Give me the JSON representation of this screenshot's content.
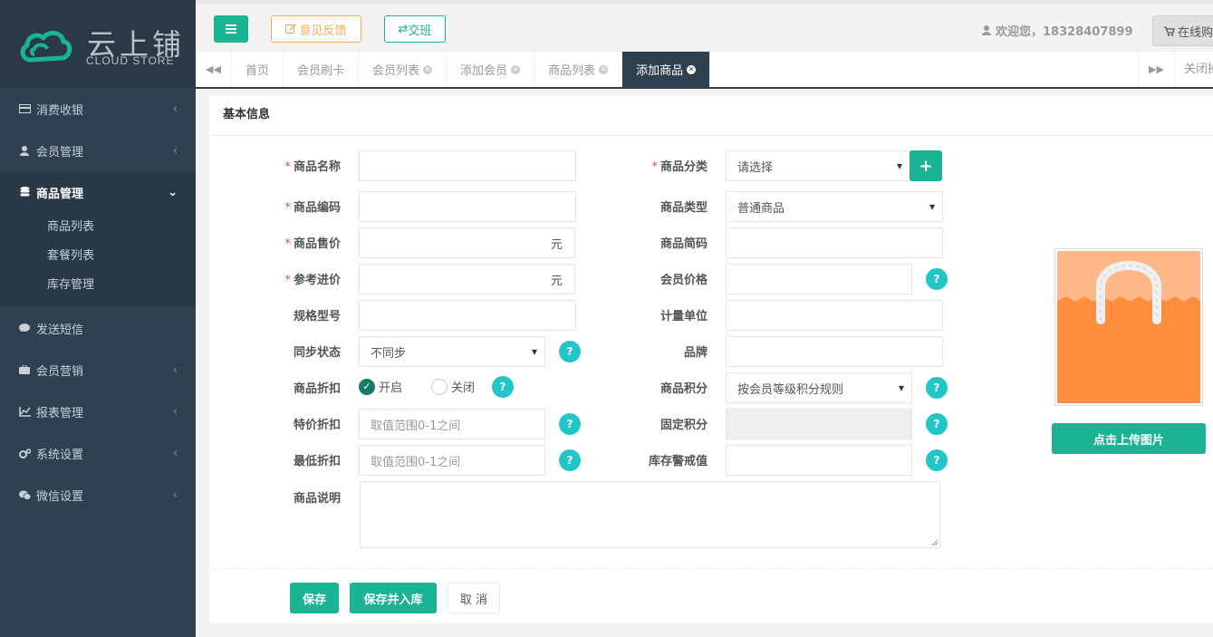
{
  "logo": {
    "name_cn": "云上铺",
    "name_en": "CLOUD STORE"
  },
  "sidebar": {
    "items": [
      {
        "label": "消费收银",
        "icon": "credit-card-icon"
      },
      {
        "label": "会员管理",
        "icon": "user-icon"
      },
      {
        "label": "商品管理",
        "icon": "database-icon",
        "active": true,
        "children": [
          "商品列表",
          "套餐列表",
          "库存管理"
        ]
      },
      {
        "label": "发送短信",
        "icon": "comment-icon"
      },
      {
        "label": "会员营销",
        "icon": "briefcase-icon"
      },
      {
        "label": "报表管理",
        "icon": "line-chart-icon"
      },
      {
        "label": "系统设置",
        "icon": "gears-icon"
      },
      {
        "label": "微信设置",
        "icon": "wechat-icon"
      }
    ]
  },
  "topbar": {
    "feedback_label": "意见反馈",
    "shift_label": "交班",
    "welcome": "欢迎您，18328407899",
    "online_label": "在线购"
  },
  "tabs": {
    "items": [
      "首页",
      "会员刷卡",
      "会员列表",
      "添加会员",
      "商品列表",
      "添加商品"
    ],
    "active": "添加商品",
    "close_label": "关闭操作"
  },
  "form": {
    "section_title": "基本信息",
    "labels": {
      "name": "商品名称",
      "category": "商品分类",
      "code": "商品编码",
      "type": "商品类型",
      "price": "商品售价",
      "short_code": "商品简码",
      "cost": "参考进价",
      "member_price": "会员价格",
      "spec": "规格型号",
      "unit": "计量单位",
      "sync": "同步状态",
      "brand": "品牌",
      "discount": "商品折扣",
      "points": "商品积分",
      "special_discount": "特价折扣",
      "fixed_points": "固定积分",
      "min_discount": "最低折扣",
      "stock_alert": "库存警戒值",
      "description": "商品说明"
    },
    "required_mark": "*",
    "currency_unit": "元",
    "category_value": "请选择",
    "type_value": "普通商品",
    "sync_value": "不同步",
    "points_value": "按会员等级积分规则",
    "discount_on": "开启",
    "discount_off": "关闭",
    "discount_placeholder": "取值范围0-1之间",
    "help_glyph": "?",
    "plus_glyph": "+"
  },
  "image": {
    "upload_label": "点击上传图片"
  },
  "actions": {
    "save": "保存",
    "save_stock": "保存并入库",
    "cancel": "取 消"
  },
  "colors": {
    "primary": "#1ab394",
    "info": "#23c6c8",
    "warning": "#f8ac59",
    "sidebar": "#2f4050"
  }
}
